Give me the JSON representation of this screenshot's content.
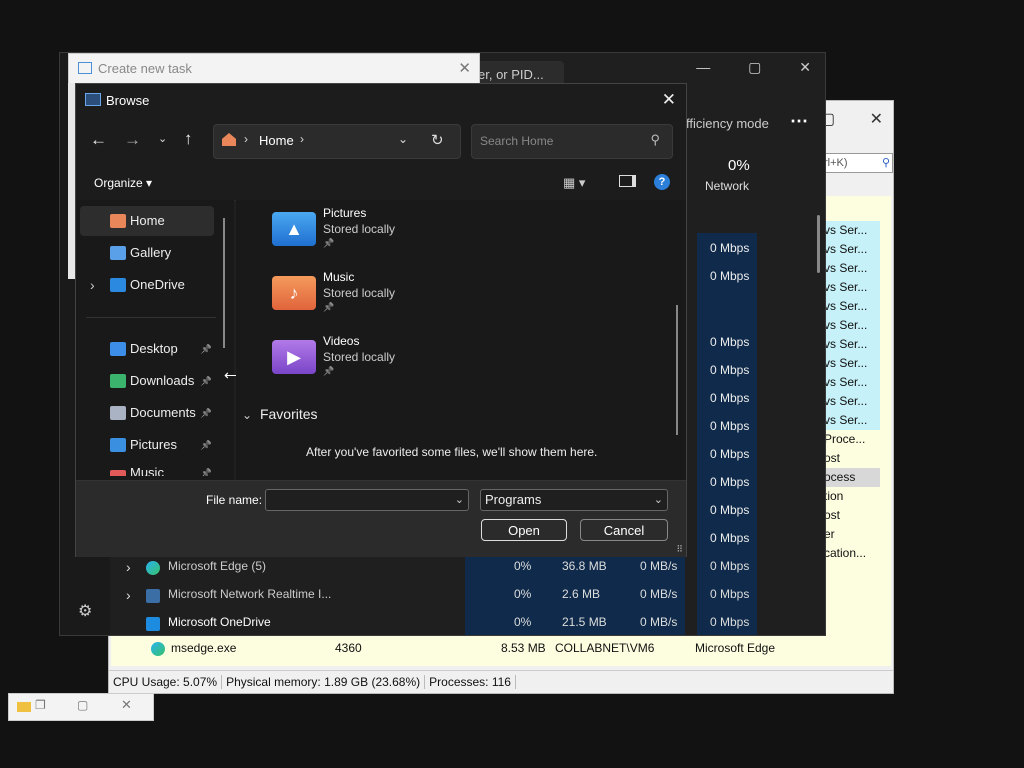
{
  "process_explorer": {
    "search_fragment": "rl+K)",
    "cyan_rows": [
      "vs Ser...",
      "vs Ser...",
      "vs Ser...",
      "vs Ser...",
      "vs Ser...",
      "vs Ser...",
      "vs Ser...",
      "vs Ser...",
      "vs Ser...",
      "vs Ser...",
      "vs Ser...",
      "Proce...",
      "ost",
      "ocess",
      "tion",
      "ost",
      "er",
      "cation..."
    ],
    "rows": [
      {
        "name": "msedge.exe",
        "pid": "4360",
        "mem": "8.53 MB",
        "user": "COLLABNET\\VM6",
        "company": "Microsoft Edge"
      }
    ],
    "status": {
      "cpu": "CPU Usage: 5.07%",
      "memory": "Physical memory: 1.89 GB (23.68%)",
      "processes": "Processes: 116"
    }
  },
  "task_manager": {
    "search_fragment": "er, or PID...",
    "efficiency_mode": "fficiency mode",
    "network_pct": "0%",
    "network_label": "Network",
    "mbps_rows": [
      "0 Mbps",
      "0 Mbps",
      "0 Mbps",
      "0 Mbps",
      "0 Mbps",
      "0 Mbps",
      "0 Mbps",
      "0 Mbps",
      "0 Mbps",
      "0 Mbps",
      "0 Mbps",
      "0 Mbps"
    ],
    "processes": [
      {
        "name": "Microsoft Edge (5)",
        "cpu": "0%",
        "mem": "36.8 MB",
        "disk": "0 MB/s",
        "net": "0 Mbps"
      },
      {
        "name": "Microsoft Network Realtime I...",
        "cpu": "0%",
        "mem": "2.6 MB",
        "disk": "0 MB/s",
        "net": "0 Mbps"
      },
      {
        "name": "Microsoft OneDrive",
        "cpu": "0%",
        "mem": "21.5 MB",
        "disk": "0 MB/s",
        "net": "0 Mbps"
      }
    ]
  },
  "create_task": {
    "title": "Create new task"
  },
  "browse": {
    "title": "Browse",
    "breadcrumb_home": "Home",
    "search_placeholder": "Search Home",
    "organize": "Organize",
    "nav": [
      {
        "label": "Home"
      },
      {
        "label": "Gallery"
      },
      {
        "label": "OneDrive"
      },
      {
        "label": "Desktop"
      },
      {
        "label": "Downloads"
      },
      {
        "label": "Documents"
      },
      {
        "label": "Pictures"
      },
      {
        "label": "Music"
      }
    ],
    "items": [
      {
        "name": "Pictures",
        "status": "Stored locally"
      },
      {
        "name": "Music",
        "status": "Stored locally"
      },
      {
        "name": "Videos",
        "status": "Stored locally"
      }
    ],
    "favorites_header": "Favorites",
    "favorites_empty": "After you've favorited some files, we'll show them here.",
    "file_name_label": "File name:",
    "file_name_value": "",
    "file_type": "Programs",
    "open_label": "Open",
    "cancel_label": "Cancel"
  }
}
